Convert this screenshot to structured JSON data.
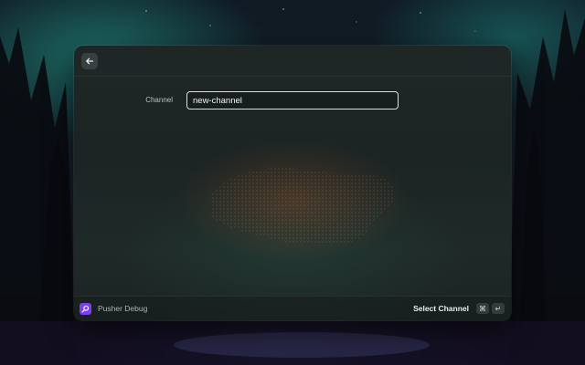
{
  "window": {
    "back_icon": "arrow-left-icon"
  },
  "form": {
    "channel_label": "Channel",
    "channel_value": "new-channel"
  },
  "footer": {
    "extension_icon": "magnifier-icon",
    "extension_name": "Pusher Debug",
    "action_label": "Select Channel",
    "shortcut_modifier": "⌘",
    "shortcut_key": "↵"
  },
  "colors": {
    "extension_accent": "#7b3ff2",
    "input_border": "#d7dcdc"
  }
}
